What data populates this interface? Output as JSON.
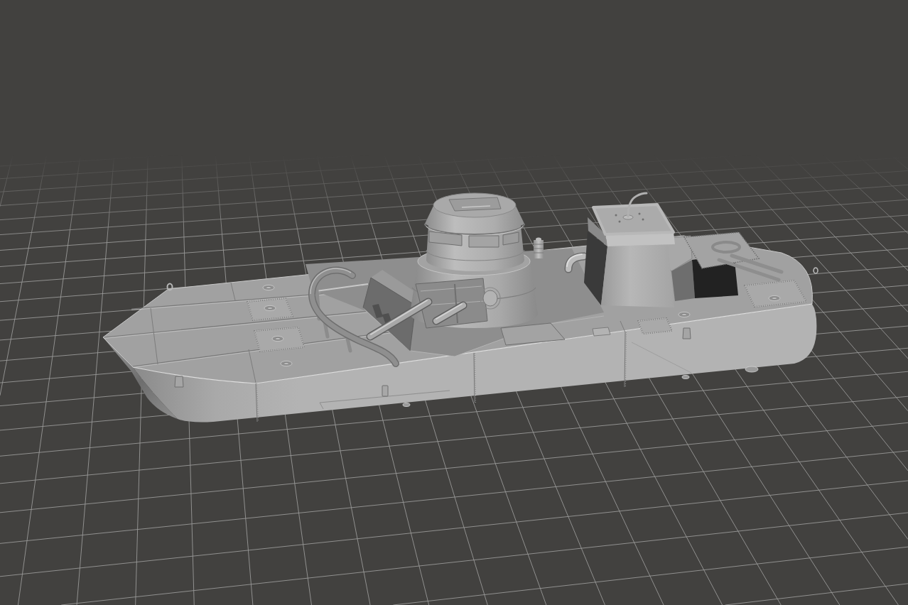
{
  "viewport": {
    "grid": true,
    "model": {
      "kind": "tank-hull"
    }
  }
}
